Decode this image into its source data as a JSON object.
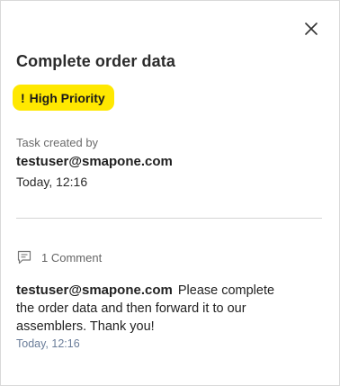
{
  "header": {
    "close_icon": "close-icon"
  },
  "task": {
    "title": "Complete order data",
    "priority": {
      "icon_glyph": "!",
      "label": "High Priority",
      "color": "#ffe800"
    },
    "created_by_label": "Task created by",
    "created_by_user": "testuser@smapone.com",
    "created_time": "Today, 12:16"
  },
  "comments": {
    "icon": "comment-icon",
    "count_label": "1 Comment",
    "items": [
      {
        "author": "testuser@smapone.com",
        "text": "Please complete the order data and then forward it to our assemblers. Thank you!",
        "time": "Today, 12:16"
      }
    ]
  }
}
